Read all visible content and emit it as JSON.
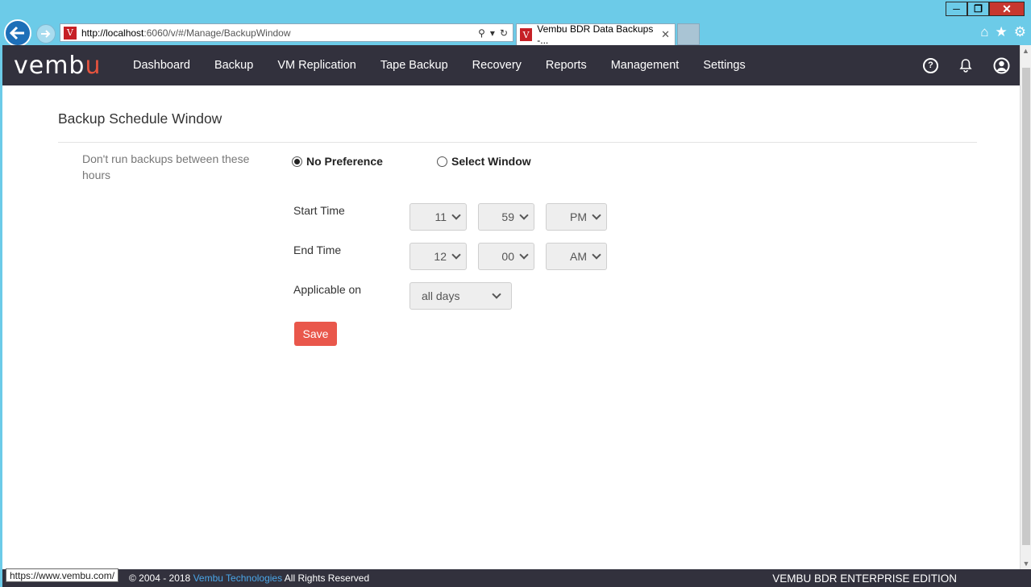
{
  "browser": {
    "address": {
      "host": "http://localhost",
      "rest": ":6060/v/#/Manage/BackupWindow"
    },
    "tab_title": "Vembu BDR Data Backups -...",
    "favicon": "V",
    "status_url": "https://www.vembu.com/"
  },
  "nav": {
    "logo_prefix": "vemb",
    "logo_accent": "u",
    "items": [
      "Dashboard",
      "Backup",
      "VM Replication",
      "Tape Backup",
      "Recovery",
      "Reports",
      "Management",
      "Settings"
    ]
  },
  "page": {
    "title": "Backup Schedule Window",
    "description": "Don't run backups between these hours",
    "options": {
      "no_preference": "No Preference",
      "select_window": "Select Window",
      "selected": "no_preference"
    },
    "start_time": {
      "label": "Start Time",
      "hour": "11",
      "minute": "59",
      "ampm": "PM"
    },
    "end_time": {
      "label": "End Time",
      "hour": "12",
      "minute": "00",
      "ampm": "AM"
    },
    "applicable": {
      "label": "Applicable on",
      "value": "all days"
    },
    "save_label": "Save"
  },
  "footer": {
    "copyright": "© 2004 - 2018",
    "company": "Vembu Technologies",
    "rights": "All Rights Reserved",
    "edition": "VEMBU BDR ENTERPRISE EDITION"
  },
  "colors": {
    "navbar": "#32313d",
    "accent": "#e5533e",
    "save": "#e9574b",
    "link": "#4aa6e8"
  }
}
